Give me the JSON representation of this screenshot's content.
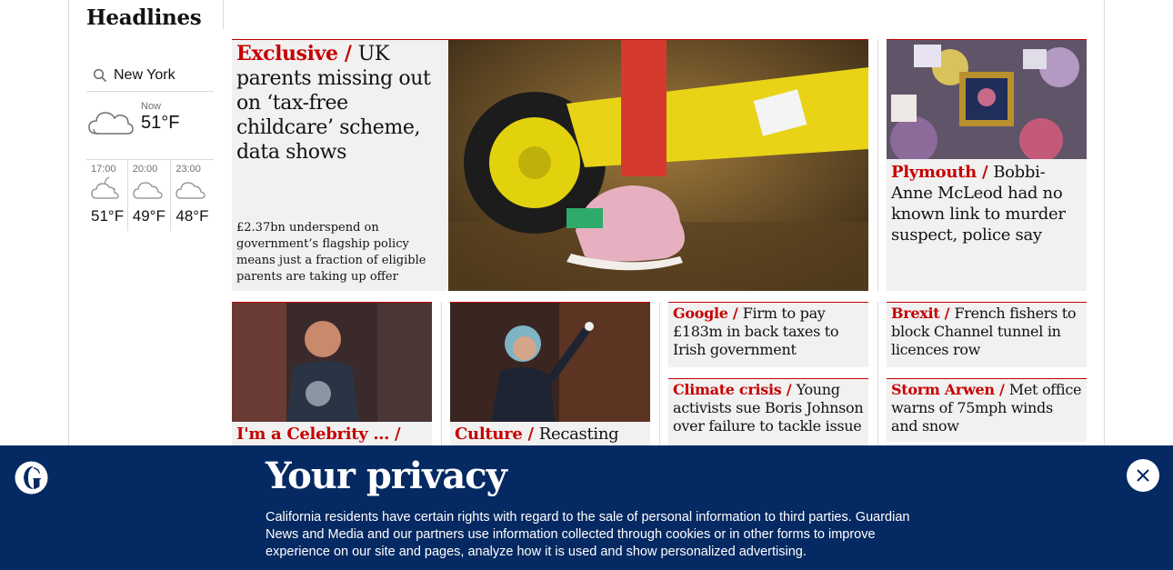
{
  "section": {
    "title": "Headlines"
  },
  "weather": {
    "location": "New York",
    "now_label": "Now",
    "now_temp": "51°F",
    "forecast": [
      {
        "time": "17:00",
        "temp": "51°F",
        "icon": "partly-cloudy-night-icon"
      },
      {
        "time": "20:00",
        "temp": "49°F",
        "icon": "cloud-icon"
      },
      {
        "time": "23:00",
        "temp": "48°F",
        "icon": "cloud-icon"
      }
    ]
  },
  "main_story": {
    "kicker": "Exclusive",
    "headline": "UK parents missing out on ‘tax-free childcare’ scheme, data shows",
    "standfirst": "£2.37bn underspend on government’s flagship policy means just a fraction of eligible parents are taking up offer"
  },
  "side_story": {
    "kicker": "Plymouth",
    "headline": "Bobbi-Anne McLeod had no known link to murder suspect, police say"
  },
  "stories": [
    {
      "kicker": "I'm a Celebrity …",
      "headline": ""
    },
    {
      "kicker": "Culture",
      "headline": "Recasting"
    },
    {
      "kicker": "Google",
      "headline": "Firm to pay £183m in back taxes to Irish government"
    },
    {
      "kicker": "Brexit",
      "headline": "French fishers to block Channel tunnel in licences row"
    },
    {
      "kicker": "Climate crisis",
      "headline": "Young activists sue Boris Johnson over failure to tackle issue"
    },
    {
      "kicker": "Storm Arwen",
      "headline": "Met office warns of 75mph winds and snow"
    }
  ],
  "separator": " / ",
  "privacy": {
    "title": "Your privacy",
    "body": "California residents have certain rights with regard to the sale of personal information to third parties. Guardian News and Media and our partners use information collected through cookies or in other forms to improve experience on our site and pages, analyze how it is used and show personalized advertising."
  },
  "colors": {
    "accent": "#c70000",
    "banner": "#052962",
    "card": "#f1f1f1"
  }
}
